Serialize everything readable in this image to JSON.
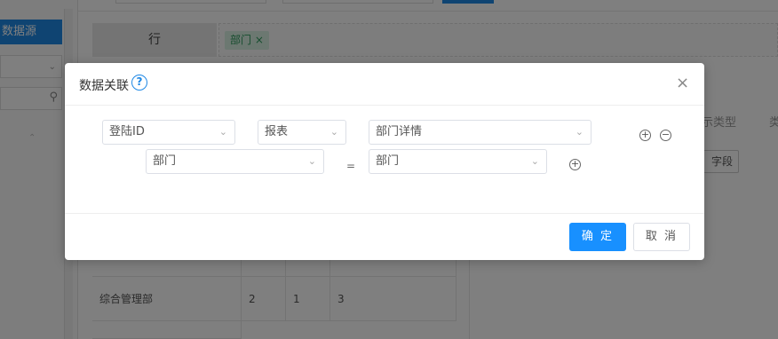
{
  "background": {
    "sidebar": {
      "datasource_label": "数据源",
      "select_chevron": "chevron-down-icon",
      "search_icon": "search-icon"
    },
    "row_area": {
      "row_label": "行",
      "tag_label": "部门 ×"
    },
    "table": {
      "rows": [
        {
          "name": "综合管理部",
          "c1": "2",
          "c2": "1",
          "c3": "3"
        }
      ]
    },
    "right_panel": {
      "type_header": "示类型",
      "type_header2": "类",
      "field_button": "字段"
    }
  },
  "dialog": {
    "title": "数据关联",
    "help_icon": "?",
    "close_icon": "×",
    "row1": {
      "left_field": "登陆ID",
      "report_type": "报表",
      "right_field": "部门详情"
    },
    "row2": {
      "left_field": "部门",
      "operator": "=",
      "right_field": "部门"
    },
    "add_symbol": "+",
    "remove_symbol": "−",
    "arrow_symbol": "⌄",
    "buttons": {
      "ok": "确 定",
      "cancel": "取 消"
    }
  },
  "colors": {
    "primary": "#1890ff",
    "sidebar_active": "#1e88e5",
    "tag_bg": "#d8f0e2",
    "tag_text": "#2e9a5e"
  }
}
